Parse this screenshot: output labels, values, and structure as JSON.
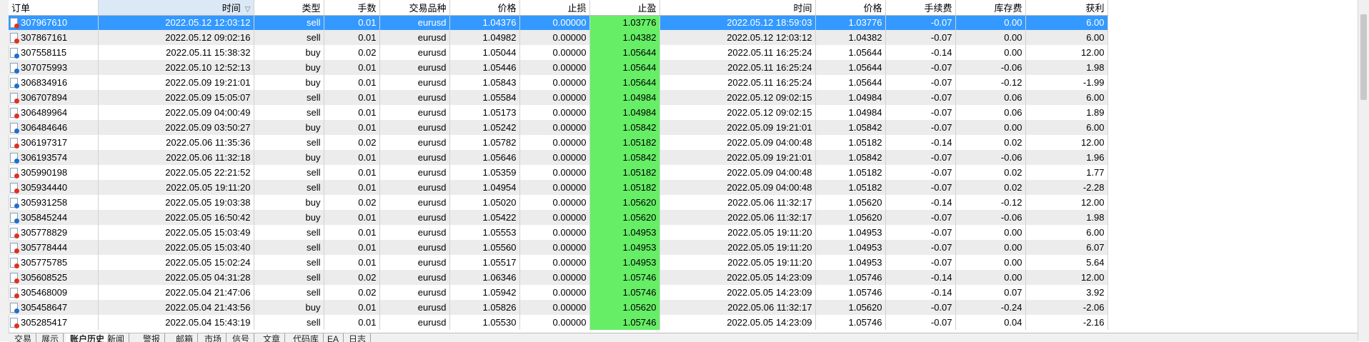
{
  "columns": [
    "订单",
    "时间",
    "类型",
    "手数",
    "交易品种",
    "价格",
    "止损",
    "止盈",
    "时间",
    "价格",
    "手续费",
    "库存费",
    "获利"
  ],
  "rows": [
    [
      "307967610",
      "2022.05.12 12:03:12",
      "sell",
      "0.01",
      "eurusd",
      "1.04376",
      "0.00000",
      "1.03776",
      "2022.05.12 18:59:03",
      "1.03776",
      "-0.07",
      "0.00",
      "6.00"
    ],
    [
      "307867161",
      "2022.05.12 09:02:16",
      "sell",
      "0.01",
      "eurusd",
      "1.04982",
      "0.00000",
      "1.04382",
      "2022.05.12 12:03:12",
      "1.04382",
      "-0.07",
      "0.00",
      "6.00"
    ],
    [
      "307558115",
      "2022.05.11 15:38:32",
      "buy",
      "0.02",
      "eurusd",
      "1.05044",
      "0.00000",
      "1.05644",
      "2022.05.11 16:25:24",
      "1.05644",
      "-0.14",
      "0.00",
      "12.00"
    ],
    [
      "307075993",
      "2022.05.10 12:52:13",
      "buy",
      "0.01",
      "eurusd",
      "1.05446",
      "0.00000",
      "1.05644",
      "2022.05.11 16:25:24",
      "1.05644",
      "-0.07",
      "-0.06",
      "1.98"
    ],
    [
      "306834916",
      "2022.05.09 19:21:01",
      "buy",
      "0.01",
      "eurusd",
      "1.05843",
      "0.00000",
      "1.05644",
      "2022.05.11 16:25:24",
      "1.05644",
      "-0.07",
      "-0.12",
      "-1.99"
    ],
    [
      "306707894",
      "2022.05.09 15:05:07",
      "sell",
      "0.01",
      "eurusd",
      "1.05584",
      "0.00000",
      "1.04984",
      "2022.05.12 09:02:15",
      "1.04984",
      "-0.07",
      "0.06",
      "6.00"
    ],
    [
      "306489964",
      "2022.05.09 04:00:49",
      "sell",
      "0.01",
      "eurusd",
      "1.05173",
      "0.00000",
      "1.04984",
      "2022.05.12 09:02:15",
      "1.04984",
      "-0.07",
      "0.06",
      "1.89"
    ],
    [
      "306484646",
      "2022.05.09 03:50:27",
      "buy",
      "0.01",
      "eurusd",
      "1.05242",
      "0.00000",
      "1.05842",
      "2022.05.09 19:21:01",
      "1.05842",
      "-0.07",
      "0.00",
      "6.00"
    ],
    [
      "306197317",
      "2022.05.06 11:35:36",
      "sell",
      "0.02",
      "eurusd",
      "1.05782",
      "0.00000",
      "1.05182",
      "2022.05.09 04:00:48",
      "1.05182",
      "-0.14",
      "0.02",
      "12.00"
    ],
    [
      "306193574",
      "2022.05.06 11:32:18",
      "buy",
      "0.01",
      "eurusd",
      "1.05646",
      "0.00000",
      "1.05842",
      "2022.05.09 19:21:01",
      "1.05842",
      "-0.07",
      "-0.06",
      "1.96"
    ],
    [
      "305990198",
      "2022.05.05 22:21:52",
      "sell",
      "0.01",
      "eurusd",
      "1.05359",
      "0.00000",
      "1.05182",
      "2022.05.09 04:00:48",
      "1.05182",
      "-0.07",
      "0.02",
      "1.77"
    ],
    [
      "305934440",
      "2022.05.05 19:11:20",
      "sell",
      "0.01",
      "eurusd",
      "1.04954",
      "0.00000",
      "1.05182",
      "2022.05.09 04:00:48",
      "1.05182",
      "-0.07",
      "0.02",
      "-2.28"
    ],
    [
      "305931258",
      "2022.05.05 19:03:38",
      "buy",
      "0.02",
      "eurusd",
      "1.05020",
      "0.00000",
      "1.05620",
      "2022.05.06 11:32:17",
      "1.05620",
      "-0.14",
      "-0.12",
      "12.00"
    ],
    [
      "305845244",
      "2022.05.05 16:50:42",
      "buy",
      "0.01",
      "eurusd",
      "1.05422",
      "0.00000",
      "1.05620",
      "2022.05.06 11:32:17",
      "1.05620",
      "-0.07",
      "-0.06",
      "1.98"
    ],
    [
      "305778829",
      "2022.05.05 15:03:49",
      "sell",
      "0.01",
      "eurusd",
      "1.05553",
      "0.00000",
      "1.04953",
      "2022.05.05 19:11:20",
      "1.04953",
      "-0.07",
      "0.00",
      "6.00"
    ],
    [
      "305778444",
      "2022.05.05 15:03:40",
      "sell",
      "0.01",
      "eurusd",
      "1.05560",
      "0.00000",
      "1.04953",
      "2022.05.05 19:11:20",
      "1.04953",
      "-0.07",
      "0.00",
      "6.07"
    ],
    [
      "305775785",
      "2022.05.05 15:02:24",
      "sell",
      "0.01",
      "eurusd",
      "1.05517",
      "0.00000",
      "1.04953",
      "2022.05.05 19:11:20",
      "1.04953",
      "-0.07",
      "0.00",
      "5.64"
    ],
    [
      "305608525",
      "2022.05.05 04:31:28",
      "sell",
      "0.02",
      "eurusd",
      "1.06346",
      "0.00000",
      "1.05746",
      "2022.05.05 14:23:09",
      "1.05746",
      "-0.14",
      "0.00",
      "12.00"
    ],
    [
      "305468009",
      "2022.05.04 21:47:06",
      "sell",
      "0.02",
      "eurusd",
      "1.05942",
      "0.00000",
      "1.05746",
      "2022.05.05 14:23:09",
      "1.05746",
      "-0.14",
      "0.07",
      "3.92"
    ],
    [
      "305458647",
      "2022.05.04 21:43:56",
      "buy",
      "0.01",
      "eurusd",
      "1.05826",
      "0.00000",
      "1.05620",
      "2022.05.06 11:32:17",
      "1.05620",
      "-0.07",
      "-0.24",
      "-2.06"
    ],
    [
      "305285417",
      "2022.05.04 15:43:19",
      "sell",
      "0.01",
      "eurusd",
      "1.05530",
      "0.00000",
      "1.05746",
      "2022.05.05 14:23:09",
      "1.05746",
      "-0.07",
      "0.04",
      "-2.16"
    ]
  ],
  "tabs": [
    "交易",
    "展示",
    "账户历史",
    "新闻",
    "警报",
    "邮箱",
    "市场",
    "信号",
    "文章",
    "代码库",
    "EA",
    "日志"
  ],
  "active_tab": "账户历史",
  "sort_arrow": "▽",
  "colors": {
    "selected": "#3399ff",
    "take_profit_fill": "#66ee66",
    "alt_row": "#ececec"
  }
}
